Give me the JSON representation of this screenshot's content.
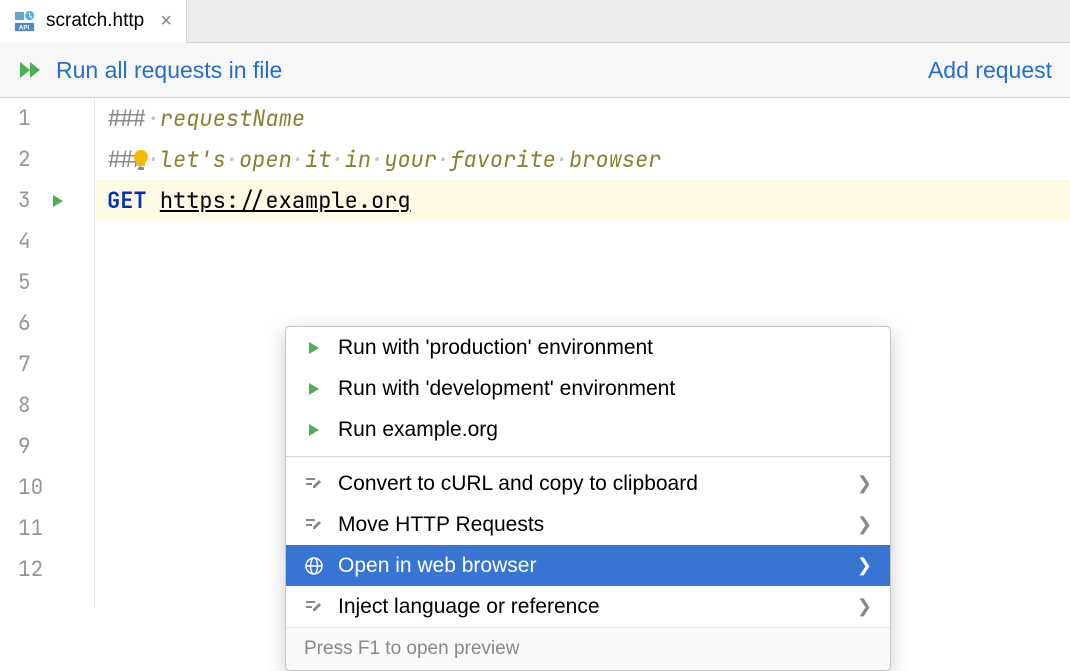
{
  "tab": {
    "filename": "scratch.http"
  },
  "toolbar": {
    "run_all_label": "Run all requests in file",
    "add_request_label": "Add request"
  },
  "editor": {
    "lines": [
      {
        "num": "1"
      },
      {
        "num": "2"
      },
      {
        "num": "3"
      },
      {
        "num": "4"
      },
      {
        "num": "5"
      },
      {
        "num": "6"
      },
      {
        "num": "7"
      },
      {
        "num": "8"
      },
      {
        "num": "9"
      },
      {
        "num": "10"
      },
      {
        "num": "11"
      },
      {
        "num": "12"
      }
    ],
    "line1": {
      "delim": "###",
      "text": "requestName"
    },
    "line2": {
      "delim": "###",
      "text": "let's open it in your favorite browser"
    },
    "line3": {
      "method": "GET",
      "url": "https://example.org"
    }
  },
  "context_menu": {
    "items": [
      {
        "label": "Run with 'production' environment",
        "icon": "play",
        "has_submenu": false
      },
      {
        "label": "Run with 'development' environment",
        "icon": "play",
        "has_submenu": false
      },
      {
        "label": "Run example.org",
        "icon": "play",
        "has_submenu": false
      },
      {
        "label": "Convert to cURL and copy to clipboard",
        "icon": "edit",
        "has_submenu": true
      },
      {
        "label": "Move HTTP Requests",
        "icon": "edit",
        "has_submenu": true
      },
      {
        "label": "Open in web browser",
        "icon": "globe",
        "has_submenu": true,
        "selected": true
      },
      {
        "label": "Inject language or reference",
        "icon": "edit",
        "has_submenu": true
      }
    ],
    "footer_text": "Press F1 to open preview"
  }
}
